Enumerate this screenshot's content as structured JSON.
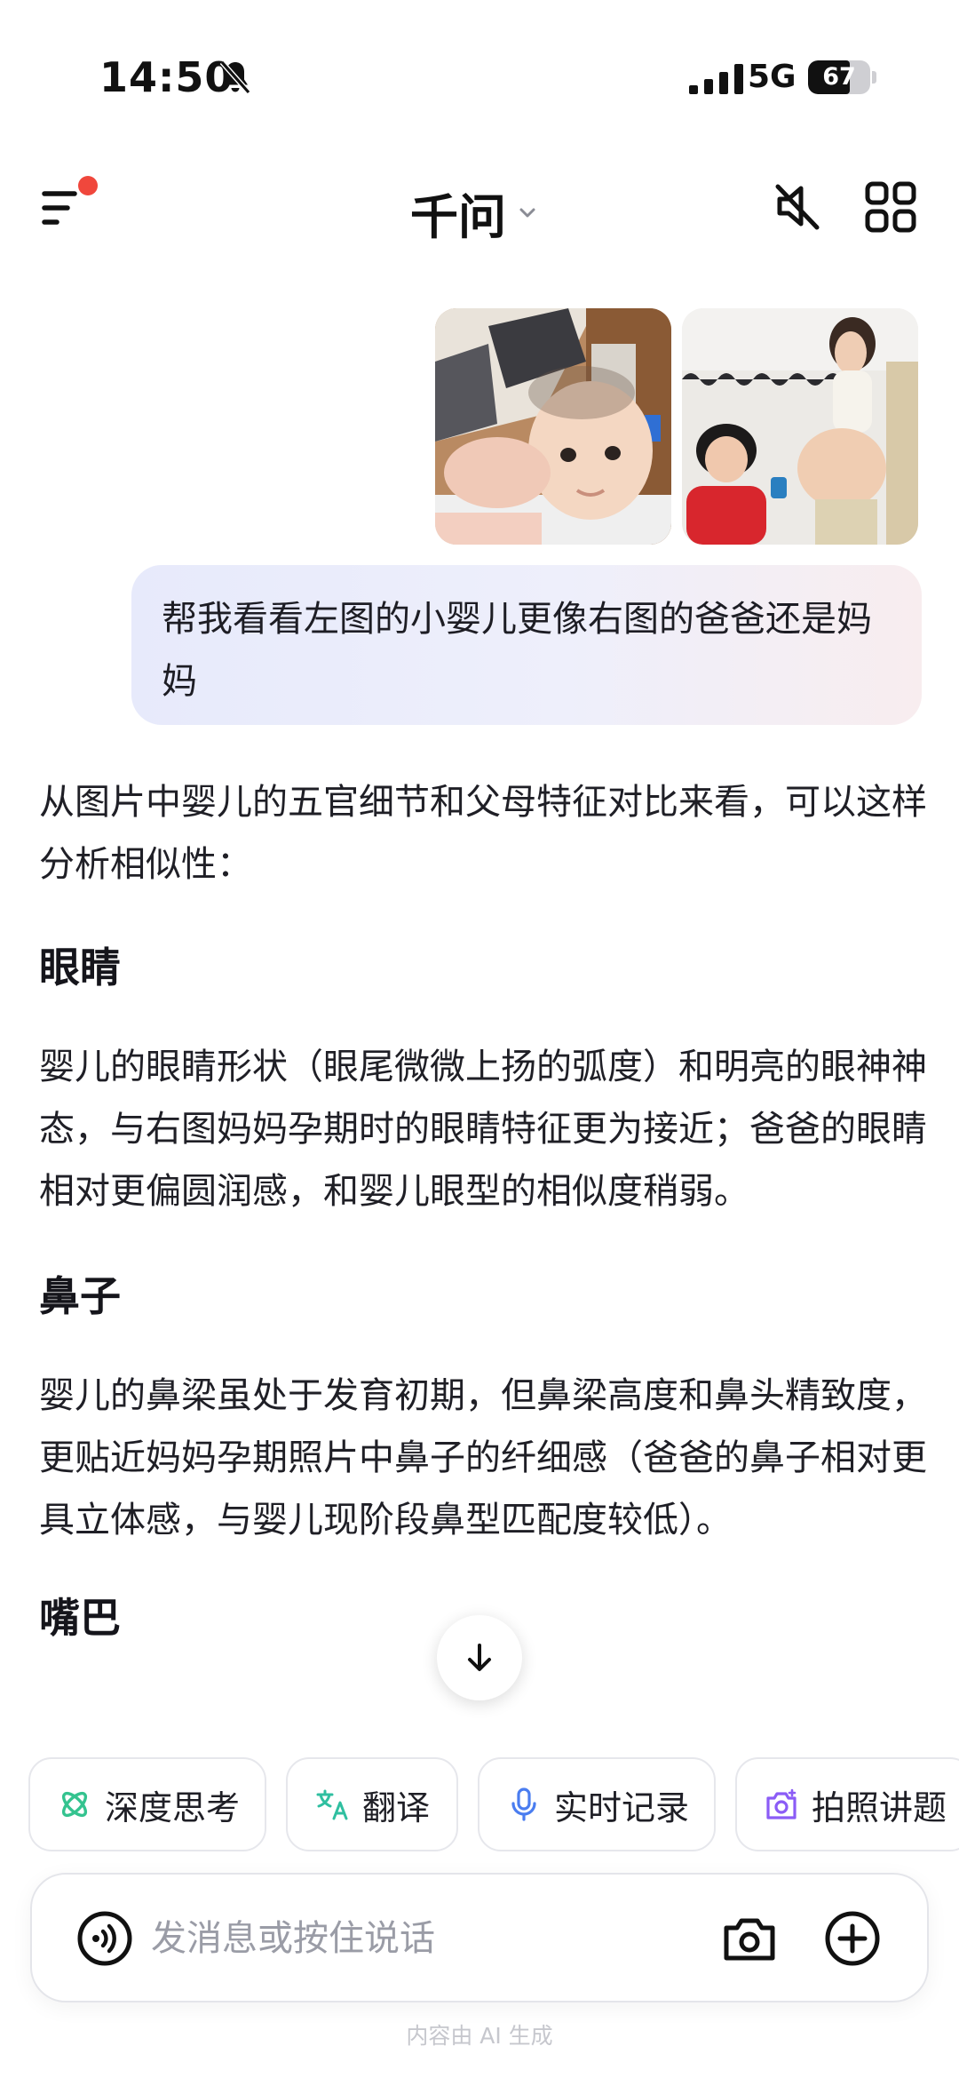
{
  "status_bar": {
    "time": "14:50",
    "network": "5G",
    "battery": "67",
    "battery_level": 0.67,
    "icons": [
      "bell-off-icon",
      "signal-icon",
      "battery-icon"
    ]
  },
  "header": {
    "title": "千问",
    "icons": [
      "menu-icon",
      "speaker-mute-icon",
      "apps-grid-icon"
    ],
    "notification_dot_color": "#f0473c"
  },
  "conversation": {
    "user_images": [
      {
        "alt": "baby-photo"
      },
      {
        "alt": "parents-photo"
      }
    ],
    "user_message": "帮我看看左图的小婴儿更像右图的爸爸还是妈妈",
    "answer": {
      "intro": "从图片中婴儿的五官细节和父母特征对比来看，可以这样分析相似性：",
      "sections": [
        {
          "heading": "眼睛",
          "body": "婴儿的眼睛形状（眼尾微微上扬的弧度）和明亮的眼神神态，与右图妈妈孕期时的眼睛特征更为接近；爸爸的眼睛相对更偏圆润感，和婴儿眼型的相似度稍弱。"
        },
        {
          "heading": "鼻子",
          "body": "婴儿的鼻梁虽处于发育初期，但鼻梁高度和鼻头精致度，更贴近妈妈孕期照片中鼻子的纤细感（爸爸的鼻子相对更具立体感，与婴儿现阶段鼻型匹配度较低）。"
        },
        {
          "heading": "嘴巴"
        }
      ]
    }
  },
  "quick_actions": [
    {
      "label": "深度思考",
      "icon": "deep-think-icon",
      "color": "#34c38f"
    },
    {
      "label": "翻译",
      "icon": "translate-icon",
      "color": "#2fbfa0"
    },
    {
      "label": "实时记录",
      "icon": "microphone-icon",
      "color": "#4a7df0"
    },
    {
      "label": "拍照讲题",
      "icon": "photo-explain-icon",
      "color": "#8b5cf6"
    }
  ],
  "input": {
    "placeholder": "发消息或按住说话",
    "value": ""
  },
  "footer": {
    "disclaimer": "内容由 AI 生成"
  },
  "colors": {
    "accent_dot": "#f0473c",
    "bubble_start": "#e7eafb",
    "bubble_end": "#f8edef"
  }
}
